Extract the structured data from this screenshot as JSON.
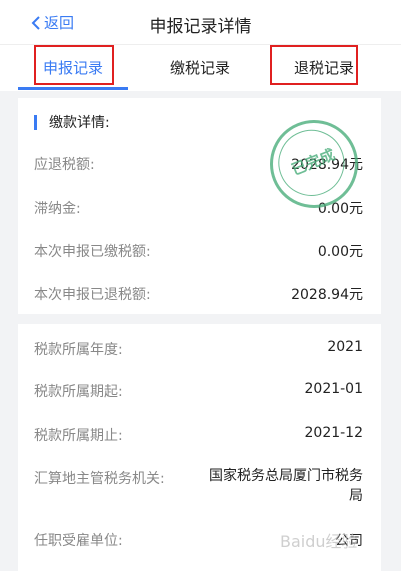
{
  "nav": {
    "back_label": "返回",
    "title": "申报记录详情"
  },
  "tabs": [
    {
      "label": "申报记录"
    },
    {
      "label": "缴税记录"
    },
    {
      "label": "退税记录"
    }
  ],
  "payment": {
    "section_title": "缴款详情:",
    "rows": [
      {
        "label": "应退税额:",
        "value": "2028.94元"
      },
      {
        "label": "滞纳金:",
        "value": "0.00元"
      },
      {
        "label": "本次申报已缴税额:",
        "value": "0.00元"
      },
      {
        "label": "本次申报已退税额:",
        "value": "2028.94元"
      }
    ],
    "stamp_text": "已完成"
  },
  "tax_info": {
    "rows": [
      {
        "label": "税款所属年度:",
        "value": "2021"
      },
      {
        "label": "税款所属期起:",
        "value": "2021-01"
      },
      {
        "label": "税款所属期止:",
        "value": "2021-12"
      },
      {
        "label": "汇算地主管税务机关:",
        "value": "国家税务总局厦门市税务局"
      },
      {
        "label": "任职受雇单位:",
        "value": "公司"
      }
    ]
  },
  "watermark": "Baidu经验",
  "colors": {
    "accent": "#3a7bf3",
    "highlight_box": "#e02020",
    "stamp": "#4cae7c"
  }
}
